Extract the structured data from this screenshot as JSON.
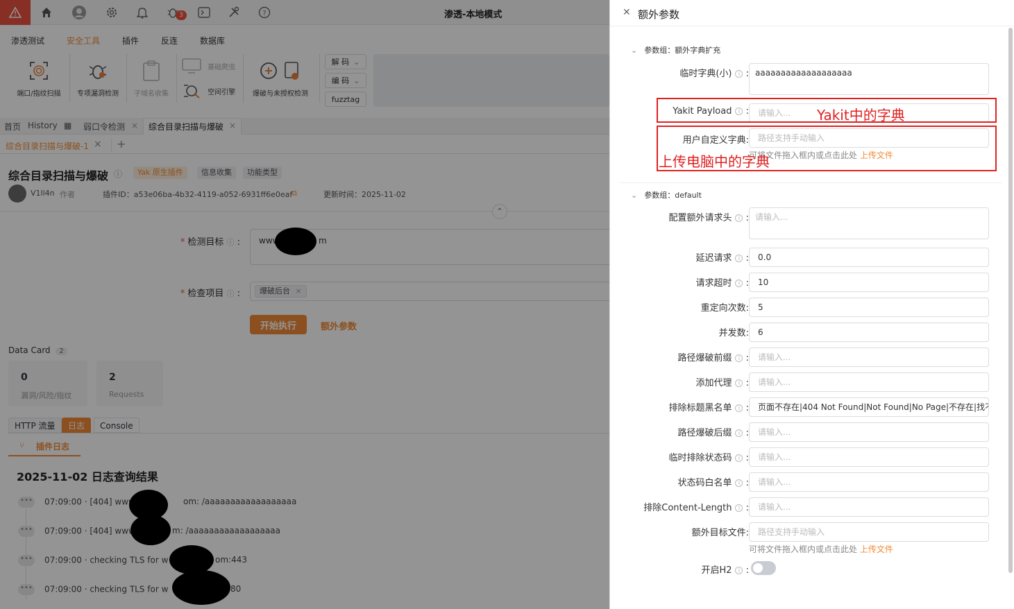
{
  "window_title": "渗透-本地模式",
  "topbar": {
    "alarm": "alarm-icon",
    "bug_badge": "3"
  },
  "menu": [
    "渗透测试",
    "安全工具",
    "插件",
    "反连",
    "数据库"
  ],
  "tools": {
    "port_scan": "端口/指纹扫描",
    "vuln_detect": "专项漏洞检测",
    "subdomain": "子域名收集",
    "crawler": "基础爬虫",
    "space_engine": "空间引擎",
    "brute_auth": "爆破与未授权检测",
    "decode": "解 码",
    "encode": "编 码",
    "fuzztag": "fuzztag"
  },
  "tabs": [
    {
      "label": "首页",
      "closable": false
    },
    {
      "label": "History",
      "closable": false
    },
    {
      "label": "弱口令检测",
      "closable": true
    },
    {
      "label": "综合目录扫描与爆破",
      "closable": true
    }
  ],
  "subtab": {
    "label": "综合目录扫描与爆破-1",
    "add": "+"
  },
  "plugin": {
    "title": "综合目录扫描与爆破",
    "tags": [
      "Yak 原生插件",
      "信息收集",
      "功能类型"
    ],
    "author": "V1ll4n",
    "author_role": "作者",
    "plugin_id": "插件ID：a53e06ba-4b32-4119-a052-6931ff6e0eaf",
    "updated": "更新时间：2025-11-02"
  },
  "form": {
    "target_label": "检测目标",
    "target_value": "www",
    "target_suffix": "m",
    "item_label": "检查项目",
    "item_tag": "爆破后台",
    "start_button": "开始执行",
    "extra_button": "额外参数"
  },
  "data_card": {
    "title": "Data Card",
    "count": "2",
    "cards": [
      {
        "value": "0",
        "label": "漏洞/风险/指纹"
      },
      {
        "value": "2",
        "label": "Requests"
      }
    ]
  },
  "result_tabs": [
    "HTTP 流量",
    "日志",
    "Console"
  ],
  "log_tab": "插件日志",
  "log": {
    "heading": "2025-11-02 日志查询结果",
    "lines": [
      "07:09:00 · [404] www",
      "07:09:00 · [404] www",
      "07:09:00 · checking TLS for w",
      "07:09:00 · checking TLS for w"
    ],
    "tails": [
      "om: /aaaaaaaaaaaaaaaaaa",
      "m: /aaaaaaaaaaaaaaaaaa",
      "om:443",
      "80"
    ]
  },
  "drawer": {
    "title": "额外参数",
    "group1": "参数组：额外字典扩充",
    "temp_dict_label": "临时字典(小)",
    "temp_dict_value": "aaaaaaaaaaaaaaaaaaa",
    "payload_label": "Yakit Payload",
    "payload_placeholder": "请输入...",
    "custom_dict_label": "用户自定义字典:",
    "custom_dict_placeholder": "路径支持手动输入",
    "upload_hint": "可将文件拖入框内或点击此处",
    "upload_link": "上传文件",
    "annot_yakit": "Yakit中的字典",
    "annot_local": "上传电脑中的字典",
    "group2": "参数组：default",
    "fields": [
      {
        "label": "配置额外请求头",
        "value": "请输入...",
        "placeholder": true,
        "info": true
      },
      {
        "label": "延迟请求",
        "value": "0.0",
        "placeholder": false,
        "info": true
      },
      {
        "label": "请求超时",
        "value": "10",
        "placeholder": false,
        "info": true
      },
      {
        "label": "重定向次数:",
        "value": "5",
        "placeholder": false,
        "info": false
      },
      {
        "label": "并发数:",
        "value": "6",
        "placeholder": false,
        "info": false
      },
      {
        "label": "路径爆破前缀",
        "value": "请输入...",
        "placeholder": true,
        "info": true
      },
      {
        "label": "添加代理",
        "value": "请输入...",
        "placeholder": true,
        "info": true
      },
      {
        "label": "排除标题黑名单",
        "value": "页面不存在|404 Not Found|Not Found|No Page|不存在|找不",
        "placeholder": false,
        "info": true
      },
      {
        "label": "路径爆破后缀",
        "value": "请输入...",
        "placeholder": true,
        "info": true
      },
      {
        "label": "临时排除状态码",
        "value": "请输入...",
        "placeholder": true,
        "info": true
      },
      {
        "label": "状态码白名单",
        "value": "请输入...",
        "placeholder": true,
        "info": true
      },
      {
        "label": "排除Content-Length",
        "value": "请输入...",
        "placeholder": true,
        "info": true
      },
      {
        "label": "额外目标文件:",
        "value": "路径支持手动输入",
        "placeholder": true,
        "info": false
      }
    ],
    "h2_label": "开启H2",
    "h2_on": false
  },
  "colors": {
    "accent": "#f28b37",
    "alarm": "#e8523f",
    "annotation": "#e02020"
  }
}
